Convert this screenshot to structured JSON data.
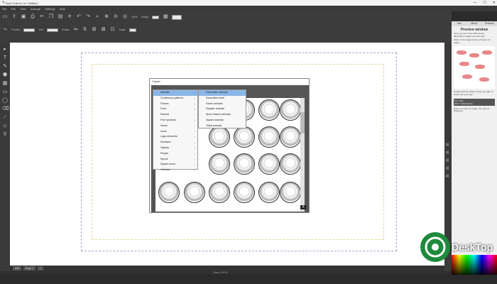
{
  "window": {
    "title": "Sure Cuts A Lot / Untitled",
    "controls": {
      "minimize": "—",
      "maximize": "☐",
      "close": "✕"
    }
  },
  "menu": [
    "File",
    "Edit",
    "View",
    "Arrange",
    "Settings",
    "Help"
  ],
  "toolbar": {
    "position_label": "Position",
    "size_label": "Size",
    "rotate_label": "Rotate",
    "zoom_value": "100%",
    "nudge_label": "Nudge",
    "angle_label": "Angle",
    "nudge_value": "0.1",
    "angle_value": "0"
  },
  "canvas": {
    "status_zoom": "Zoom: 100 %",
    "page_tabs": [
      "Mat",
      "Page 1",
      "+"
    ]
  },
  "right_panel": {
    "tabs": [
      "Info",
      "Mirror",
      "Preview"
    ],
    "title": "Preview window",
    "text1": "Here you can import EPS and AI (Illustrator) images into your sign.",
    "text2": "Click on the image below to browse for clipart.",
    "text3": "Double-click the clipart image you want to import into your sign.",
    "list_items": [
      "GO: Swirl",
      "GRO: Tribal Sketch"
    ],
    "text4": "When you click an image, the name is displayed."
  },
  "clipart_dialog": {
    "title": "Clipart",
    "category_select": "No Glass Utensils",
    "menu": [
      {
        "label": "Animals",
        "highlighted": true
      },
      {
        "label": "Continuous patterns",
        "highlighted": false
      },
      {
        "label": "Flames",
        "highlighted": false
      },
      {
        "label": "Food",
        "highlighted": false
      },
      {
        "label": "Frames",
        "highlighted": false
      },
      {
        "label": "Free symbols",
        "highlighted": false
      },
      {
        "label": "Home",
        "highlighted": false
      },
      {
        "label": "Icons",
        "highlighted": false
      },
      {
        "label": "Logo elements",
        "highlighted": false
      },
      {
        "label": "Numbers",
        "highlighted": false
      },
      {
        "label": "Objects",
        "highlighted": false
      },
      {
        "label": "People",
        "highlighted": false
      },
      {
        "label": "Sports",
        "highlighted": false
      },
      {
        "label": "Square icons",
        "highlighted": false
      },
      {
        "label": "Vehicles",
        "highlighted": false
      }
    ],
    "submenu": [
      {
        "label": "Decorative animals",
        "highlighted": true
      },
      {
        "label": "Decorative birds",
        "highlighted": false
      },
      {
        "label": "Flame animals",
        "highlighted": false
      },
      {
        "label": "Regular animals",
        "highlighted": false
      },
      {
        "label": "Sport mascot animals",
        "highlighted": false
      },
      {
        "label": "Square animals",
        "highlighted": false
      },
      {
        "label": "Tribal animals",
        "highlighted": false
      }
    ],
    "close_label": "X"
  },
  "watermark": {
    "brand": "DeskTop"
  },
  "colors": {
    "menu_highlight": "#8ab6e8",
    "canvas_bg": "#ffffff",
    "chrome": "#3c3c3c"
  }
}
